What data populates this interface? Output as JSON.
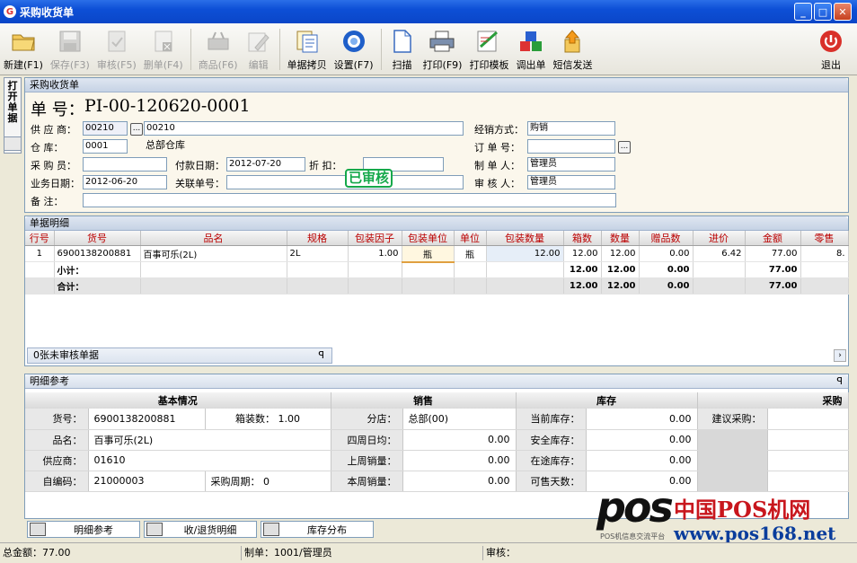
{
  "window": {
    "title": "采购收货单",
    "icon": "app-logo-icon"
  },
  "toolbar": [
    {
      "label": "新建(F1)",
      "icon": "new-folder-icon",
      "enabled": true
    },
    {
      "label": "保存(F3)",
      "icon": "save-icon",
      "enabled": false
    },
    {
      "label": "审核(F5)",
      "icon": "approve-icon",
      "enabled": false
    },
    {
      "label": "删单(F4)",
      "icon": "delete-doc-icon",
      "enabled": false
    },
    {
      "label": "商品(F6)",
      "icon": "basket-icon",
      "enabled": false
    },
    {
      "label": "编辑",
      "icon": "edit-icon",
      "enabled": false
    },
    {
      "label": "单据拷贝",
      "icon": "copy-doc-icon",
      "enabled": true
    },
    {
      "label": "设置(F7)",
      "icon": "settings-icon",
      "enabled": true
    },
    {
      "label": "扫描",
      "icon": "scan-icon",
      "enabled": true
    },
    {
      "label": "打印(F9)",
      "icon": "printer-icon",
      "enabled": true
    },
    {
      "label": "打印模板",
      "icon": "print-template-icon",
      "enabled": true
    },
    {
      "label": "调出单",
      "icon": "transfer-icon",
      "enabled": true
    },
    {
      "label": "短信发送",
      "icon": "sms-icon",
      "enabled": true
    }
  ],
  "exit_label": "退出",
  "side_tab": "打开单据",
  "header": {
    "panel_title": "采购收货单",
    "doc_label": "单  号：",
    "doc_no": "PI-00-120620-0001",
    "supplier_label": "供 应 商：",
    "supplier_code": "00210",
    "supplier_name": "00210",
    "warehouse_label": "仓    库：",
    "warehouse_code": "0001",
    "warehouse_name": "总部仓库",
    "buyer_label": "采 购 员：",
    "buyer": "",
    "paydate_label": "付款日期：",
    "paydate": "2012-07-20",
    "discount_label": "折    扣：",
    "discount": "",
    "bizdate_label": "业务日期：",
    "bizdate": "2012-06-20",
    "related_label": "关联单号：",
    "related": "",
    "remark_label": "备    注：",
    "remark": "",
    "mode_label": "经销方式：",
    "mode": "购销",
    "order_label": "订 单 号：",
    "order": "",
    "maker_label": "制 单 人：",
    "maker": "管理员",
    "auditor_label": "审 核 人：",
    "auditor": "管理员",
    "stamp": "已审核"
  },
  "detail": {
    "panel_title": "单据明细",
    "columns": [
      "行号",
      "货号",
      "品名",
      "规格",
      "包装因子",
      "包装单位",
      "单位",
      "包装数量",
      "箱数",
      "数量",
      "赠品数",
      "进价",
      "金额",
      "零售"
    ],
    "rows": [
      [
        "1",
        "6900138200881",
        "百事可乐(2L)",
        "2L",
        "1.00",
        "瓶",
        "瓶",
        "12.00",
        "12.00",
        "12.00",
        "0.00",
        "6.42",
        "77.00",
        "8."
      ]
    ],
    "subtotal": {
      "label": "小计：",
      "boxes": "12.00",
      "qty": "12.00",
      "gift": "0.00",
      "amount": "77.00"
    },
    "total": {
      "label": "合计：",
      "boxes": "12.00",
      "qty": "12.00",
      "gift": "0.00",
      "amount": "77.00"
    }
  },
  "unaudited": "0张未审核单据",
  "reference": {
    "panel_title": "明细参考",
    "groups": [
      "基本情况",
      "销售",
      "库存",
      "采购"
    ],
    "item_no_label": "货号：",
    "item_no": "6900138200881",
    "box_label": "箱装数：",
    "box": "1.00",
    "name_label": "品名：",
    "name": "百事可乐(2L)",
    "supplier_label": "供应商：",
    "supplier": "01610",
    "selfcode_label": "自编码：",
    "selfcode": "21000003",
    "cycle_label": "采购周期：",
    "cycle": "0",
    "store_label": "分店：",
    "store": "总部(00)",
    "avg4w_label": "四周日均：",
    "avg4w": "0.00",
    "lastweek_label": "上周销量：",
    "lastweek": "0.00",
    "thisweek_label": "本周销量：",
    "thisweek": "0.00",
    "stock_label": "当前库存：",
    "stock": "0.00",
    "safe_label": "安全库存：",
    "safe": "0.00",
    "transit_label": "在途库存：",
    "transit": "0.00",
    "days_label": "可售天数：",
    "days": "0.00",
    "suggest_label": "建议采购：",
    "suggest": ""
  },
  "bottom_tabs": [
    "明细参考",
    "收/退货明细",
    "库存分布"
  ],
  "status": {
    "total": "总金额：77.00",
    "maker": "制单：1001/管理员",
    "audit": "审核："
  },
  "watermark": {
    "brand": "pos",
    "cn": "中国POS机网",
    "url": "www.pos168.net",
    "tag": "POS机信息交流平台"
  }
}
